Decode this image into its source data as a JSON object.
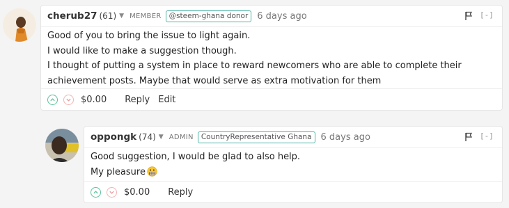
{
  "comments": [
    {
      "author": "cherub27",
      "reputation": "(61)",
      "role": "MEMBER",
      "badge": "@steem-ghana donor",
      "date": "6 days ago",
      "collapse": "[-]",
      "lines": [
        "Good of you to bring the issue to light again.",
        "I would like to make a suggestion though.",
        "I thought of putting a system in place to reward newcomers who are able to complete their achievement posts. Maybe that would serve as extra motivation for them"
      ],
      "payout": "$0.00",
      "reply_label": "Reply",
      "edit_label": "Edit"
    },
    {
      "author": "oppongk",
      "reputation": "(74)",
      "role": "ADMIN",
      "badge": "CountryRepresentative Ghana",
      "date": "6 days ago",
      "collapse": "[-]",
      "lines": [
        "Good suggestion, I would be glad to also help.",
        "My pleasure"
      ],
      "payout": "$0.00",
      "reply_label": "Reply"
    }
  ],
  "colors": {
    "upvote": "#5cc29a",
    "downvote": "#f2b4b4",
    "badge_border": "#49b3a6"
  }
}
